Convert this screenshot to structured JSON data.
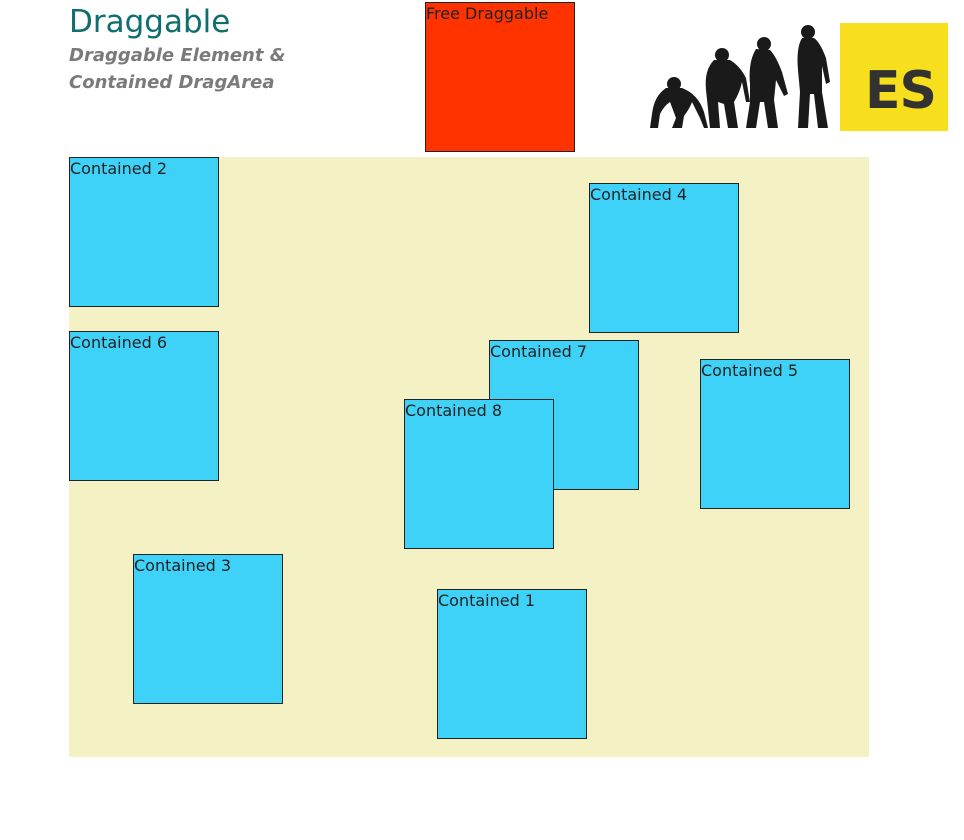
{
  "header": {
    "title": "Draggable",
    "subtitle_line1": "Draggable Element &",
    "subtitle_line2": "Contained DragArea"
  },
  "free_box": {
    "label": "Free Draggable",
    "color": "#ff3300"
  },
  "drag_area": {
    "color": "#f4f2c4"
  },
  "contained_boxes": {
    "color": "#3fd2f8",
    "box1": "Contained 1",
    "box2": "Contained 2",
    "box3": "Contained 3",
    "box4": "Contained 4",
    "box5": "Contained 5",
    "box6": "Contained 6",
    "box7": "Contained 7",
    "box8": "Contained 8"
  },
  "logo": {
    "badge_text": "ES",
    "badge_color": "#f7df1e",
    "evolution_icon": "human-evolution-silhouette"
  }
}
